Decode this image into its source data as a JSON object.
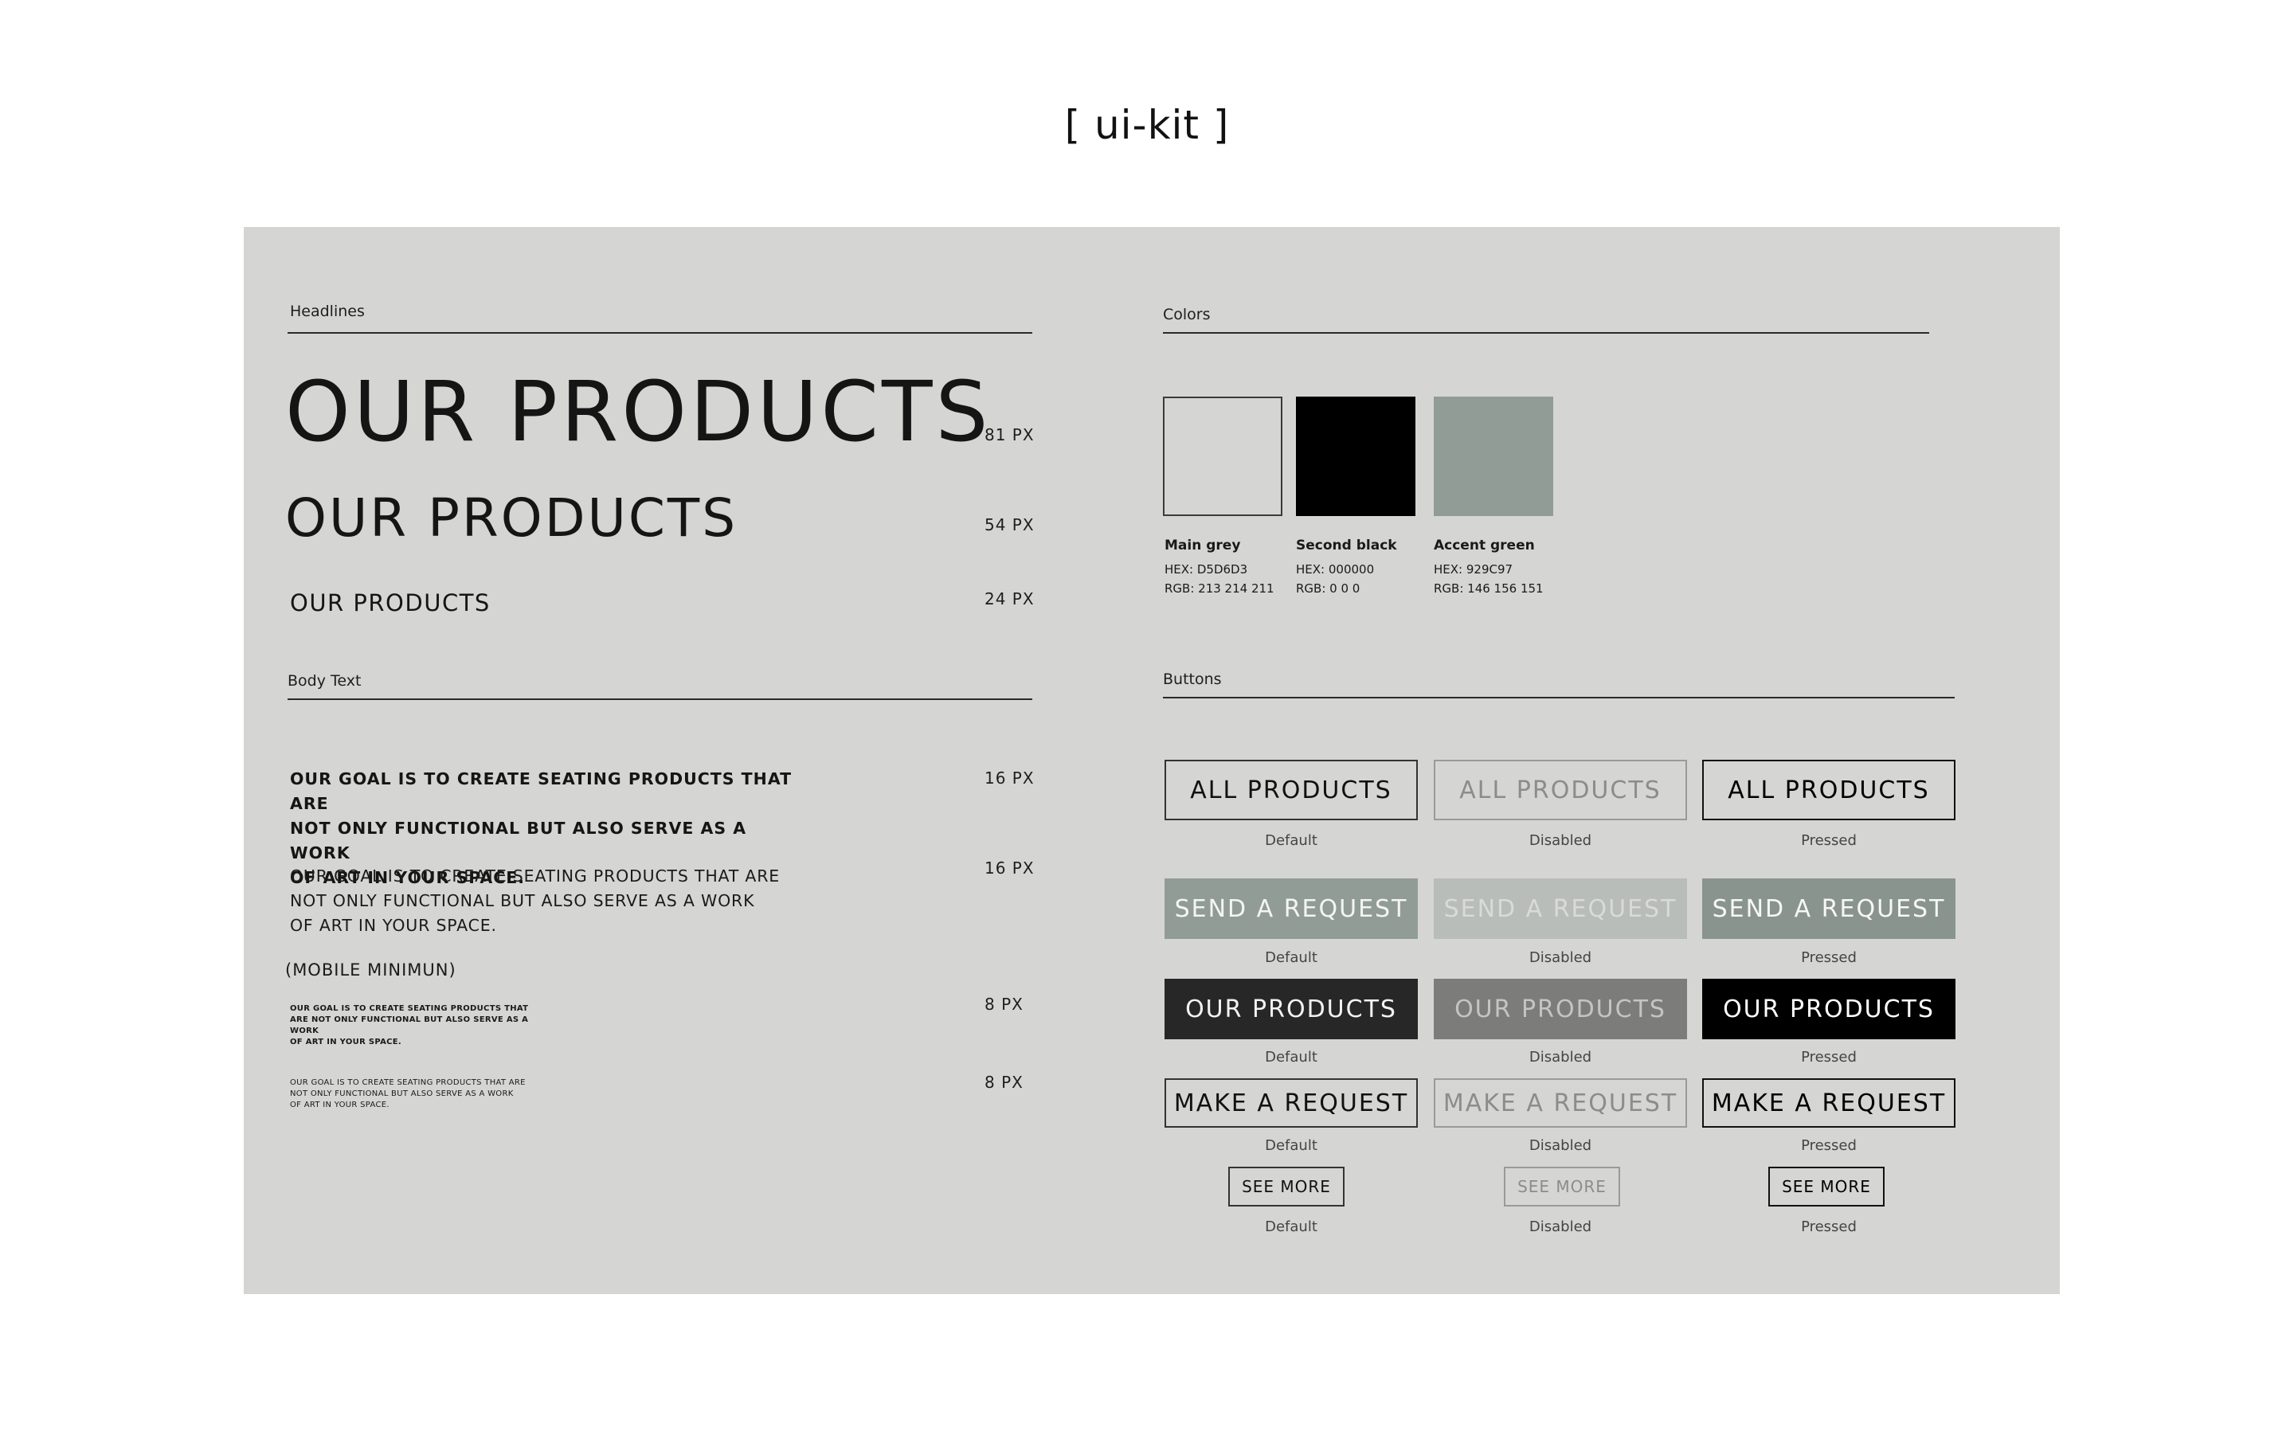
{
  "title": "[ ui-kit ]",
  "headlines": {
    "label": "Headlines",
    "items": [
      {
        "text": "OUR PRODUCTS",
        "size": "81 PX"
      },
      {
        "text": "OUR PRODUCTS",
        "size": "54 PX"
      },
      {
        "text": "OUR PRODUCTS",
        "size": "24 PX"
      }
    ]
  },
  "body_text": {
    "label": "Body Text",
    "bold_para": [
      "OUR GOAL IS TO CREATE SEATING PRODUCTS THAT ARE",
      "NOT ONLY FUNCTIONAL BUT ALSO SERVE AS A WORK",
      "OF ART IN YOUR SPACE."
    ],
    "bold_size": "16 PX",
    "regular_para": [
      "OUR GOAL IS TO CREATE SEATING PRODUCTS THAT ARE",
      "NOT ONLY FUNCTIONAL BUT ALSO SERVE AS A WORK",
      "OF ART IN YOUR SPACE."
    ],
    "regular_size": "16 PX",
    "mobile_label": "(MOBILE MINIMUN)",
    "mobile_bold_para": [
      "OUR GOAL IS TO CREATE SEATING PRODUCTS THAT",
      "ARE NOT ONLY FUNCTIONAL BUT ALSO SERVE AS A",
      "WORK",
      "OF ART IN YOUR SPACE."
    ],
    "mobile_bold_size": "8 PX",
    "mobile_regular_para": [
      "OUR GOAL IS TO CREATE SEATING PRODUCTS THAT ARE",
      "NOT ONLY FUNCTIONAL BUT ALSO SERVE AS A WORK",
      "OF ART IN YOUR SPACE."
    ],
    "mobile_regular_size": "8 PX"
  },
  "colors": {
    "label": "Colors",
    "swatches": [
      {
        "name": "Main grey",
        "hex": "HEX: D5D6D3",
        "rgb": "RGB: 213 214 211",
        "color": "#D5D6D3"
      },
      {
        "name": "Second black",
        "hex": "HEX: 000000",
        "rgb": "RGB: 0 0 0",
        "color": "#000000"
      },
      {
        "name": "Accent green",
        "hex": "HEX: 929C97",
        "rgb": "RGB: 146 156 151",
        "color": "#929C97"
      }
    ]
  },
  "buttons": {
    "label": "Buttons",
    "states": [
      "Default",
      "Disabled",
      "Pressed"
    ],
    "rows": [
      {
        "label": "ALL PRODUCTS",
        "style": "outline"
      },
      {
        "label": "SEND A REQUEST",
        "style": "green"
      },
      {
        "label": "OUR PRODUCTS",
        "style": "dark"
      },
      {
        "label": "MAKE A REQUEST",
        "style": "outline"
      },
      {
        "label": "SEE MORE",
        "style": "outline-small"
      }
    ]
  }
}
